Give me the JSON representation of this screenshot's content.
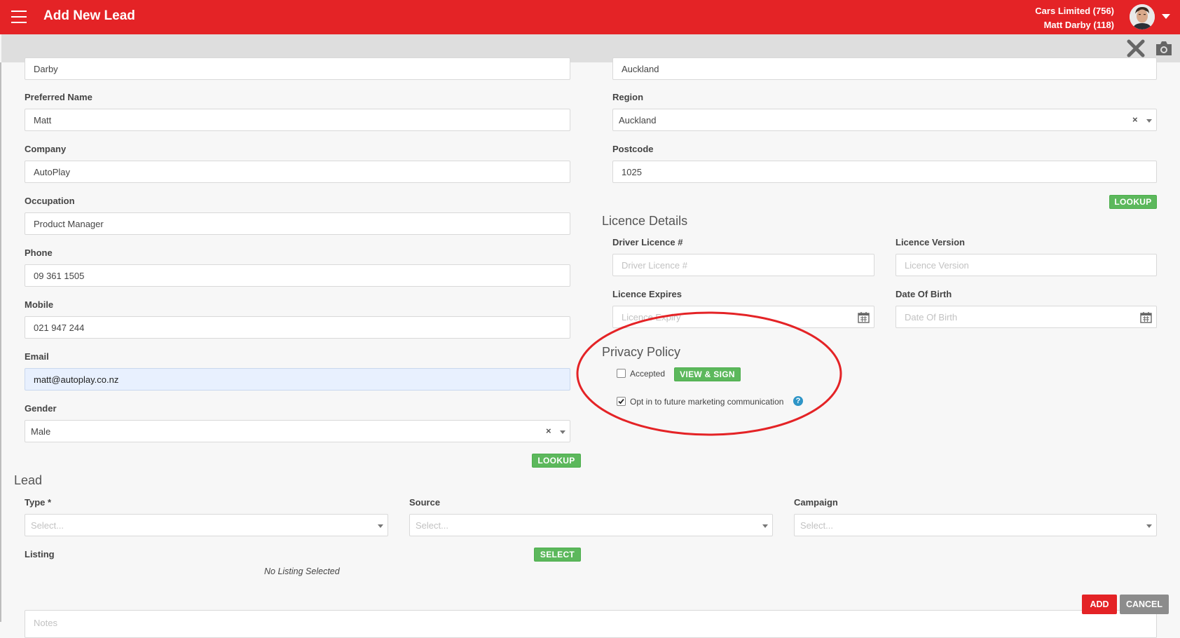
{
  "header": {
    "title": "Add New Lead",
    "account_line1": "Cars Limited (756)",
    "account_line2": "Matt Darby (118)",
    "icons": [
      "hamburger-icon",
      "user-avatar",
      "chevron-down-icon",
      "close-icon",
      "camera-icon"
    ]
  },
  "left": {
    "last_name_value": "Darby",
    "preferred_name_label": "Preferred Name",
    "preferred_name_value": "Matt",
    "company_label": "Company",
    "company_value": "AutoPlay",
    "occupation_label": "Occupation",
    "occupation_value": "Product Manager",
    "phone_label": "Phone",
    "phone_value": "09 361 1505",
    "mobile_label": "Mobile",
    "mobile_value": "021 947 244",
    "email_label": "Email",
    "email_value": "matt@autoplay.co.nz",
    "gender_label": "Gender",
    "gender_value": "Male",
    "clear_symbol": "×",
    "lookup_label": "LOOKUP"
  },
  "right": {
    "city_value": "Auckland",
    "region_label": "Region",
    "region_value": "Auckland",
    "postcode_label": "Postcode",
    "postcode_value": "1025",
    "lookup_label": "LOOKUP"
  },
  "licence": {
    "title": "Licence Details",
    "driver_licence_label": "Driver Licence #",
    "driver_licence_placeholder": "Driver Licence #",
    "version_label": "Licence Version",
    "version_placeholder": "Licence Version",
    "expires_label": "Licence Expires",
    "expires_placeholder": "Licence Expiry",
    "dob_label": "Date Of Birth",
    "dob_placeholder": "Date Of Birth"
  },
  "privacy": {
    "title": "Privacy Policy",
    "accepted_label": "Accepted",
    "accepted_checked": false,
    "view_sign_label": "VIEW & SIGN",
    "optin_label": "Opt in to future marketing communication",
    "optin_checked": true,
    "help_symbol": "?"
  },
  "lead": {
    "title": "Lead",
    "type_label": "Type *",
    "type_placeholder": "Select...",
    "source_label": "Source",
    "source_placeholder": "Select...",
    "campaign_label": "Campaign",
    "campaign_placeholder": "Select...",
    "listing_label": "Listing",
    "select_button": "SELECT",
    "no_listing": "No Listing Selected",
    "notes_placeholder": "Notes"
  },
  "actions": {
    "add_label": "ADD",
    "cancel_label": "CANCEL"
  },
  "colors": {
    "brand_red": "#e42326",
    "green_button": "#5cb85c",
    "grey_button": "#8c8c8c",
    "help_blue": "#2e95c7",
    "annotation_red": "#e42326"
  }
}
